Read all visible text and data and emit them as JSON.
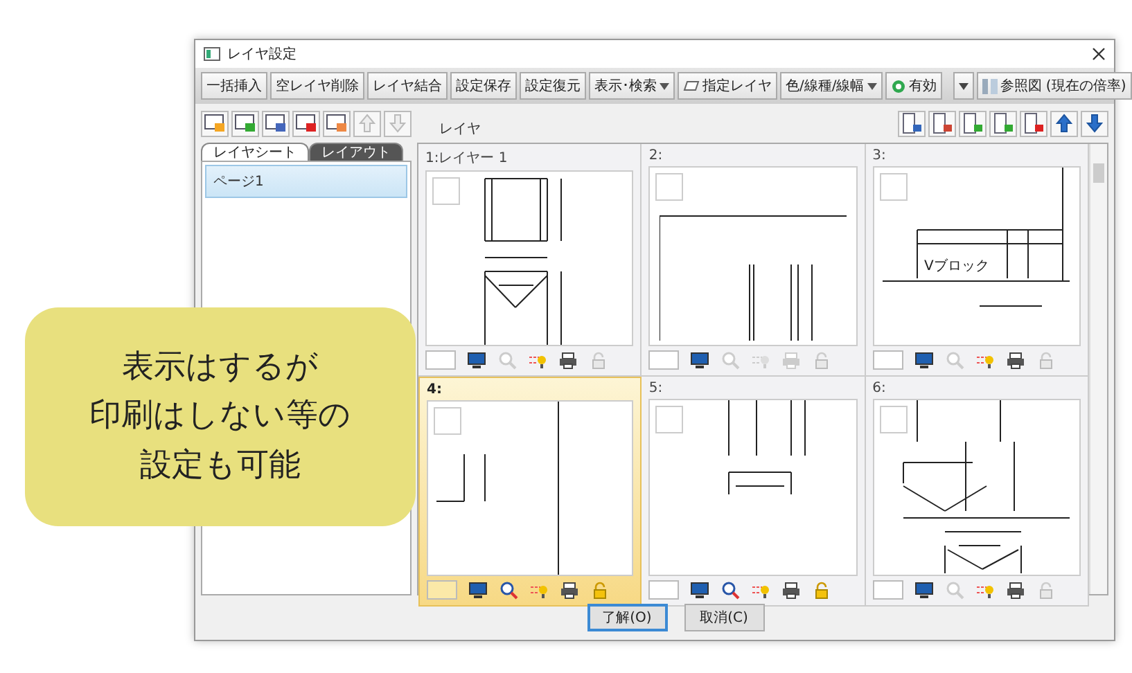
{
  "window": {
    "title": "レイヤ設定"
  },
  "toolbar": [
    {
      "kind": "button",
      "label": "一括挿入"
    },
    {
      "kind": "button",
      "label": "空レイヤ削除"
    },
    {
      "kind": "button",
      "label": "レイヤ結合"
    },
    {
      "kind": "button",
      "label": "設定保存"
    },
    {
      "kind": "button",
      "label": "設定復元"
    },
    {
      "kind": "dropdown",
      "label": "表示･検索"
    },
    {
      "kind": "layer_button",
      "label": "指定レイヤ"
    },
    {
      "kind": "dropdown",
      "label": "色/線種/線幅"
    },
    {
      "kind": "toggle",
      "label": "有効",
      "on": true
    }
  ],
  "toolbar_right": {
    "label": "参照図 (現在の倍率)"
  },
  "sheet_arrows": [
    {
      "disabled": true
    },
    {
      "disabled": true
    }
  ],
  "layer_arrows": [
    {
      "disabled": false
    },
    {
      "disabled": false
    }
  ],
  "grid_title": "レイヤ",
  "tabs": [
    {
      "label": "レイヤシート",
      "selected": true
    },
    {
      "label": "レイアウト",
      "selected": false
    }
  ],
  "sheets": [
    {
      "label": "ページ1",
      "selected": true
    }
  ],
  "layers": [
    {
      "label": "1:レイヤー 1",
      "selected": false,
      "visible": true,
      "searchable": false,
      "snap": true,
      "printable": true,
      "locked": false
    },
    {
      "label": "2:",
      "selected": false,
      "visible": true,
      "searchable": false,
      "snap": false,
      "printable": false,
      "locked": false
    },
    {
      "label": "3:",
      "selected": false,
      "visible": true,
      "searchable": false,
      "snap": true,
      "printable": true,
      "locked": false,
      "drawing_text": "Vブロック"
    },
    {
      "label": "4:",
      "selected": true,
      "visible": true,
      "searchable": true,
      "snap": true,
      "printable": true,
      "locked": true
    },
    {
      "label": "5:",
      "selected": false,
      "visible": true,
      "searchable": true,
      "snap": true,
      "printable": true,
      "locked": true
    },
    {
      "label": "6:",
      "selected": false,
      "visible": true,
      "searchable": false,
      "snap": true,
      "printable": true,
      "locked": false
    }
  ],
  "buttons": [
    {
      "label": "了解(O)",
      "default": true
    },
    {
      "label": "取消(C)",
      "default": false
    }
  ],
  "callout": {
    "lines": [
      "表示はするが",
      "印刷はしない等の",
      "設定も可能"
    ]
  }
}
